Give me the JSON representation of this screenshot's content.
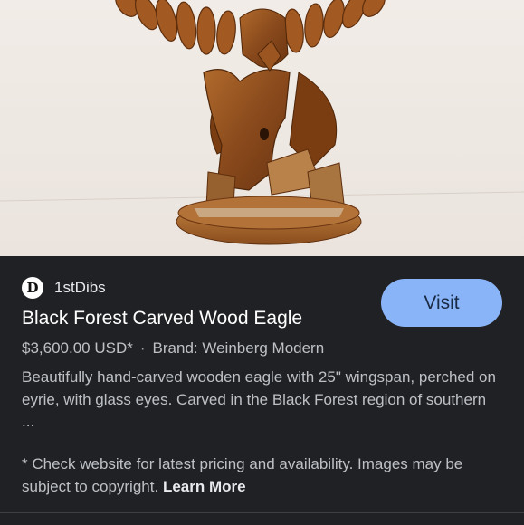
{
  "image": {
    "subject_icon": "carved-wood-eagle-photo"
  },
  "source": {
    "favicon_letter": "D",
    "name": "1stDibs"
  },
  "visit_label": "Visit",
  "product": {
    "title": "Black Forest Carved Wood Eagle",
    "price": "$3,600.00 USD*",
    "separator": "·",
    "brand": "Brand: Weinberg Modern",
    "description": "Beautifully hand-carved wooden eagle with 25\" wingspan, perched on eyrie, with glass eyes. Carved in the Black Forest region of southern ..."
  },
  "footer": {
    "notice": "* Check website for latest pricing and availability. Images may be subject to copyright.",
    "learn_more": "Learn More"
  },
  "colors": {
    "background": "#202124",
    "accent": "#8ab4f8"
  }
}
